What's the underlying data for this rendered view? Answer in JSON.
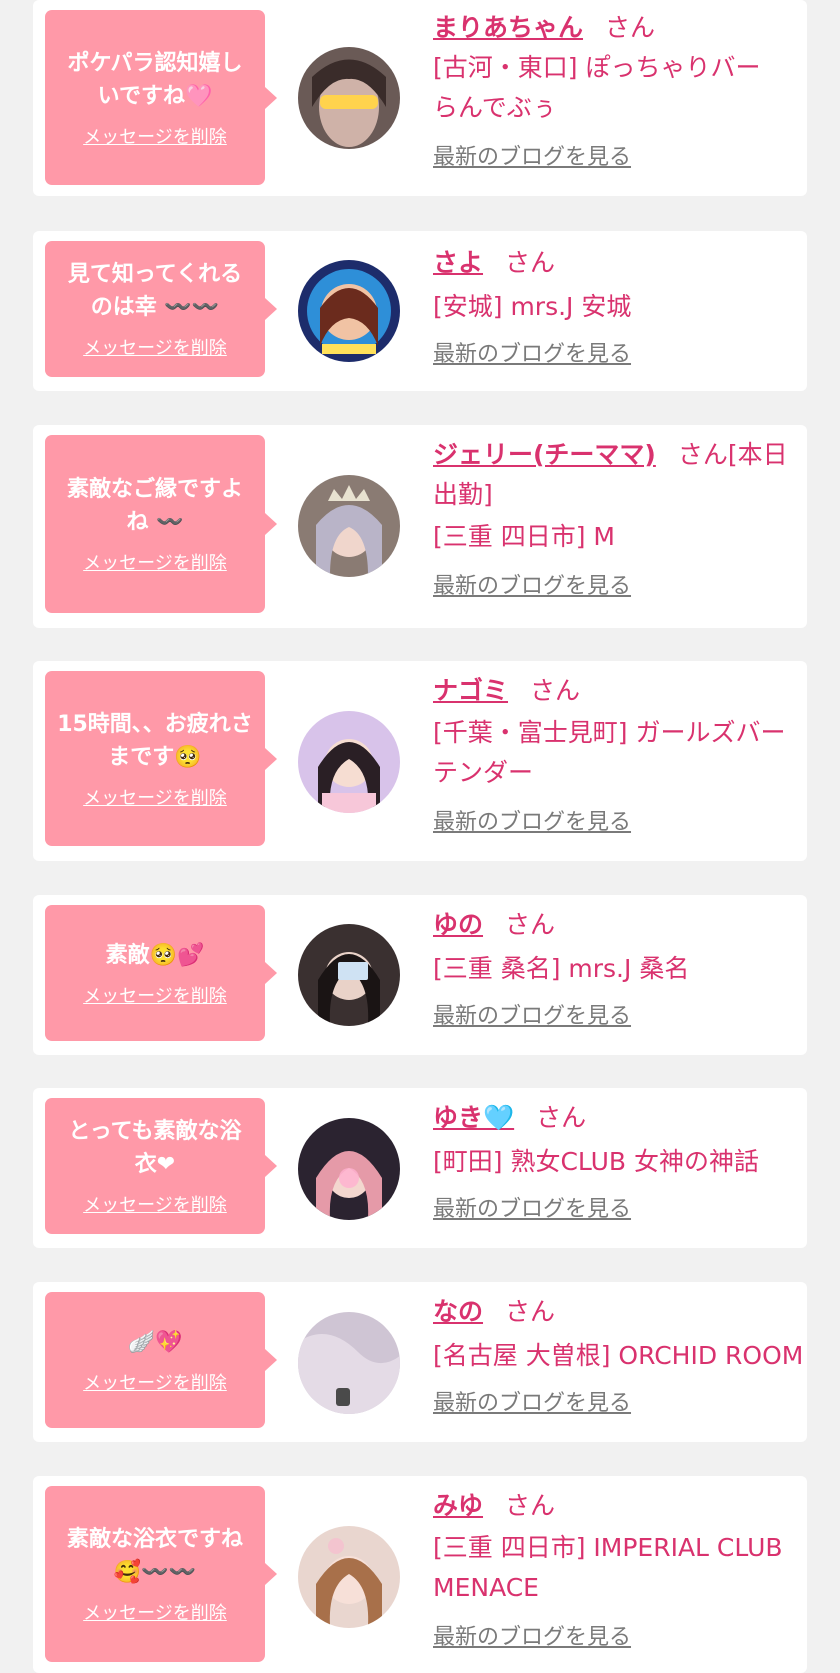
{
  "delete_label": "メッセージを削除",
  "blog_label": "最新のブログを見る",
  "san_suffix": "さん",
  "colors": {
    "accent": "#d9326e",
    "bubble": "#ff99a8",
    "background": "#f1f1f1",
    "card": "#ffffff",
    "link_gray": "#7a7a7a"
  },
  "entries": [
    {
      "message": "ポケパラ認知嬉しいですね🩷",
      "name": "まりあちゃん",
      "name_suffix": "さん",
      "shop": "[古河・東口] ぽっちゃりバー らんでぶぅ"
    },
    {
      "message": "見て知ってくれるのは幸 〰️〰️",
      "name": "さよ",
      "name_suffix": "さん",
      "shop": "[安城] mrs.J 安城"
    },
    {
      "message": "素敵なご縁ですよね 〰️",
      "name": "ジェリー(チーママ)",
      "name_suffix": "さん[本日出勤]",
      "shop": "[三重 四日市] M"
    },
    {
      "message": "15時間、、お疲れさまです🥺",
      "name": "ナゴミ",
      "name_suffix": "さん",
      "shop": "[千葉・富士見町] ガールズバーテンダー"
    },
    {
      "message": "素敵🥺💕",
      "name": "ゆの",
      "name_suffix": "さん",
      "shop": "[三重 桑名] mrs.J 桑名"
    },
    {
      "message": "とっても素敵な浴衣❤",
      "name": "ゆき🩵",
      "name_suffix": "さん",
      "shop": "[町田] 熟女CLUB 女神の神話"
    },
    {
      "message": "🪽💖",
      "name": "なの",
      "name_suffix": "さん",
      "shop": "[名古屋 大曽根] ORCHID ROOM"
    },
    {
      "message": "素敵な浴衣ですね🥰〰️〰️",
      "name": "みゆ",
      "name_suffix": "さん",
      "shop": "[三重 四日市] IMPERIAL CLUB MENACE"
    }
  ]
}
